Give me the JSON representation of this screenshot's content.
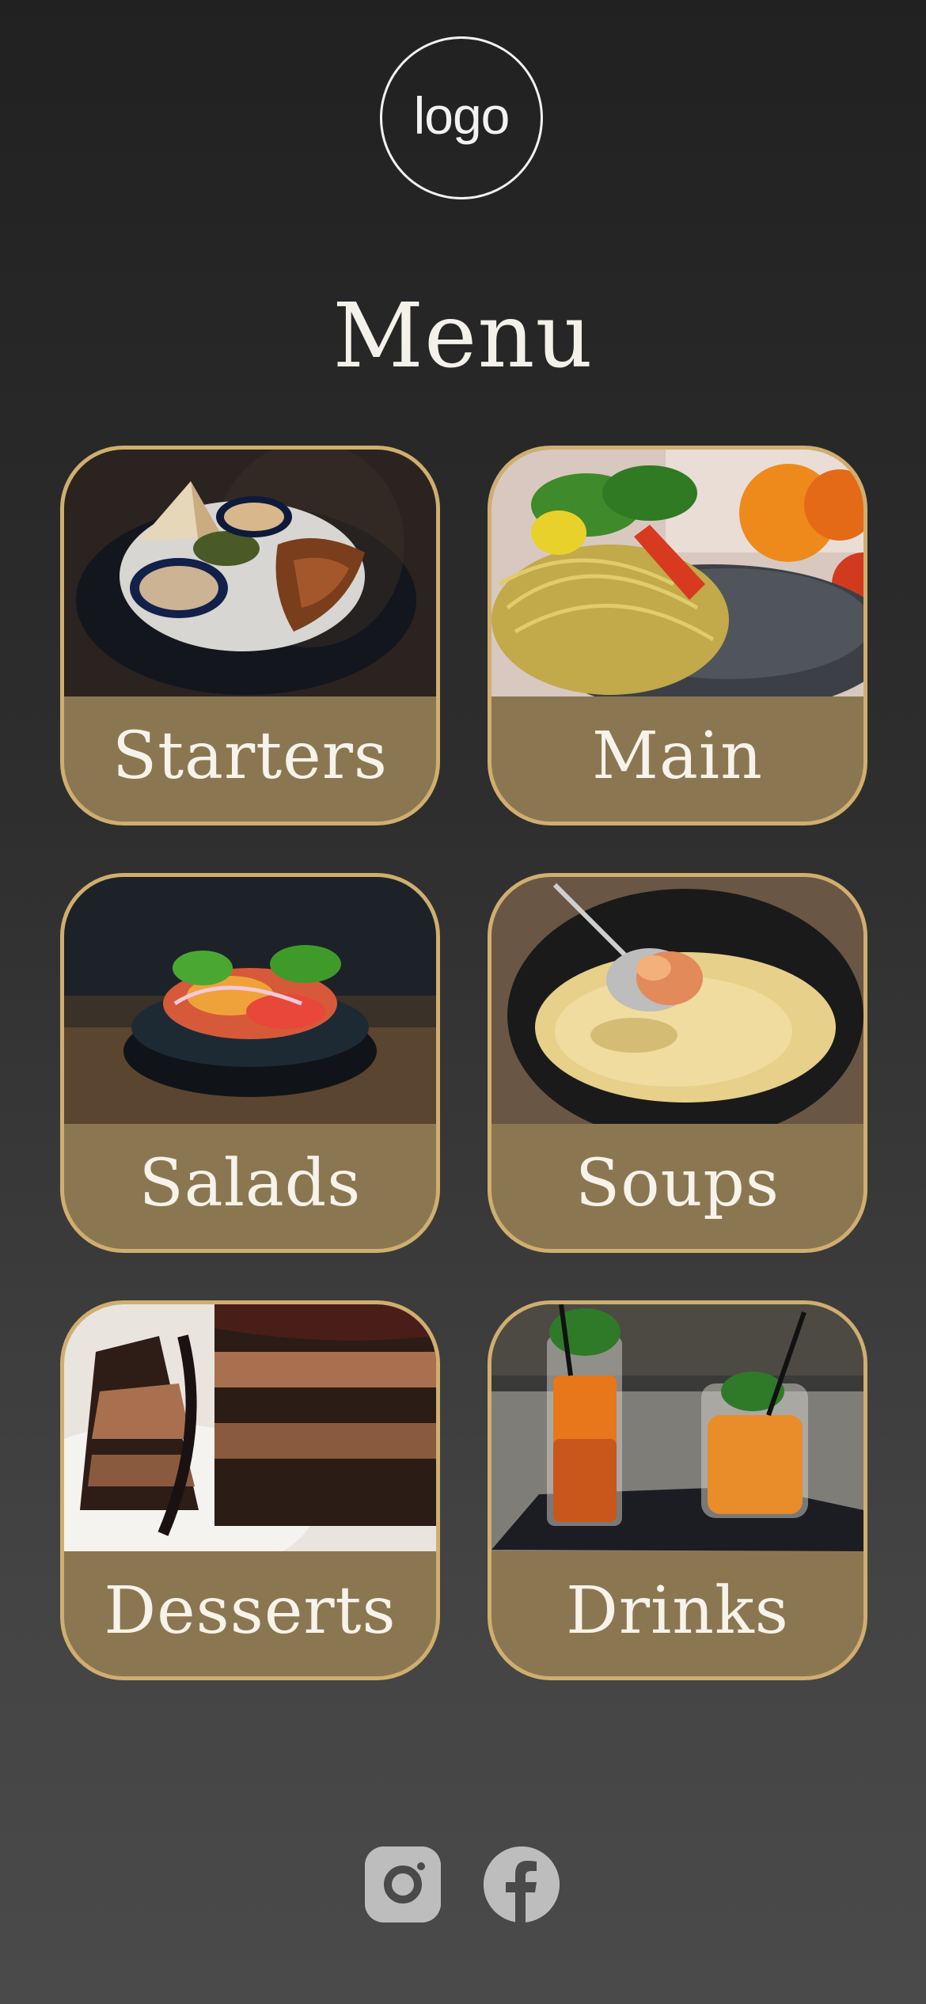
{
  "logo": {
    "text": "logo"
  },
  "title": "Menu",
  "categories": [
    {
      "label": "Starters",
      "image": "starters-photo"
    },
    {
      "label": "Main",
      "image": "main-photo"
    },
    {
      "label": "Salads",
      "image": "salads-photo"
    },
    {
      "label": "Soups",
      "image": "soups-photo"
    },
    {
      "label": "Desserts",
      "image": "desserts-photo"
    },
    {
      "label": "Drinks",
      "image": "drinks-photo"
    }
  ],
  "social": [
    {
      "icon": "instagram-icon"
    },
    {
      "icon": "facebook-icon"
    }
  ],
  "colors": {
    "card_fill": "#8a7752",
    "card_border": "#d0ae6e",
    "social_icon": "#bdbdbd"
  }
}
